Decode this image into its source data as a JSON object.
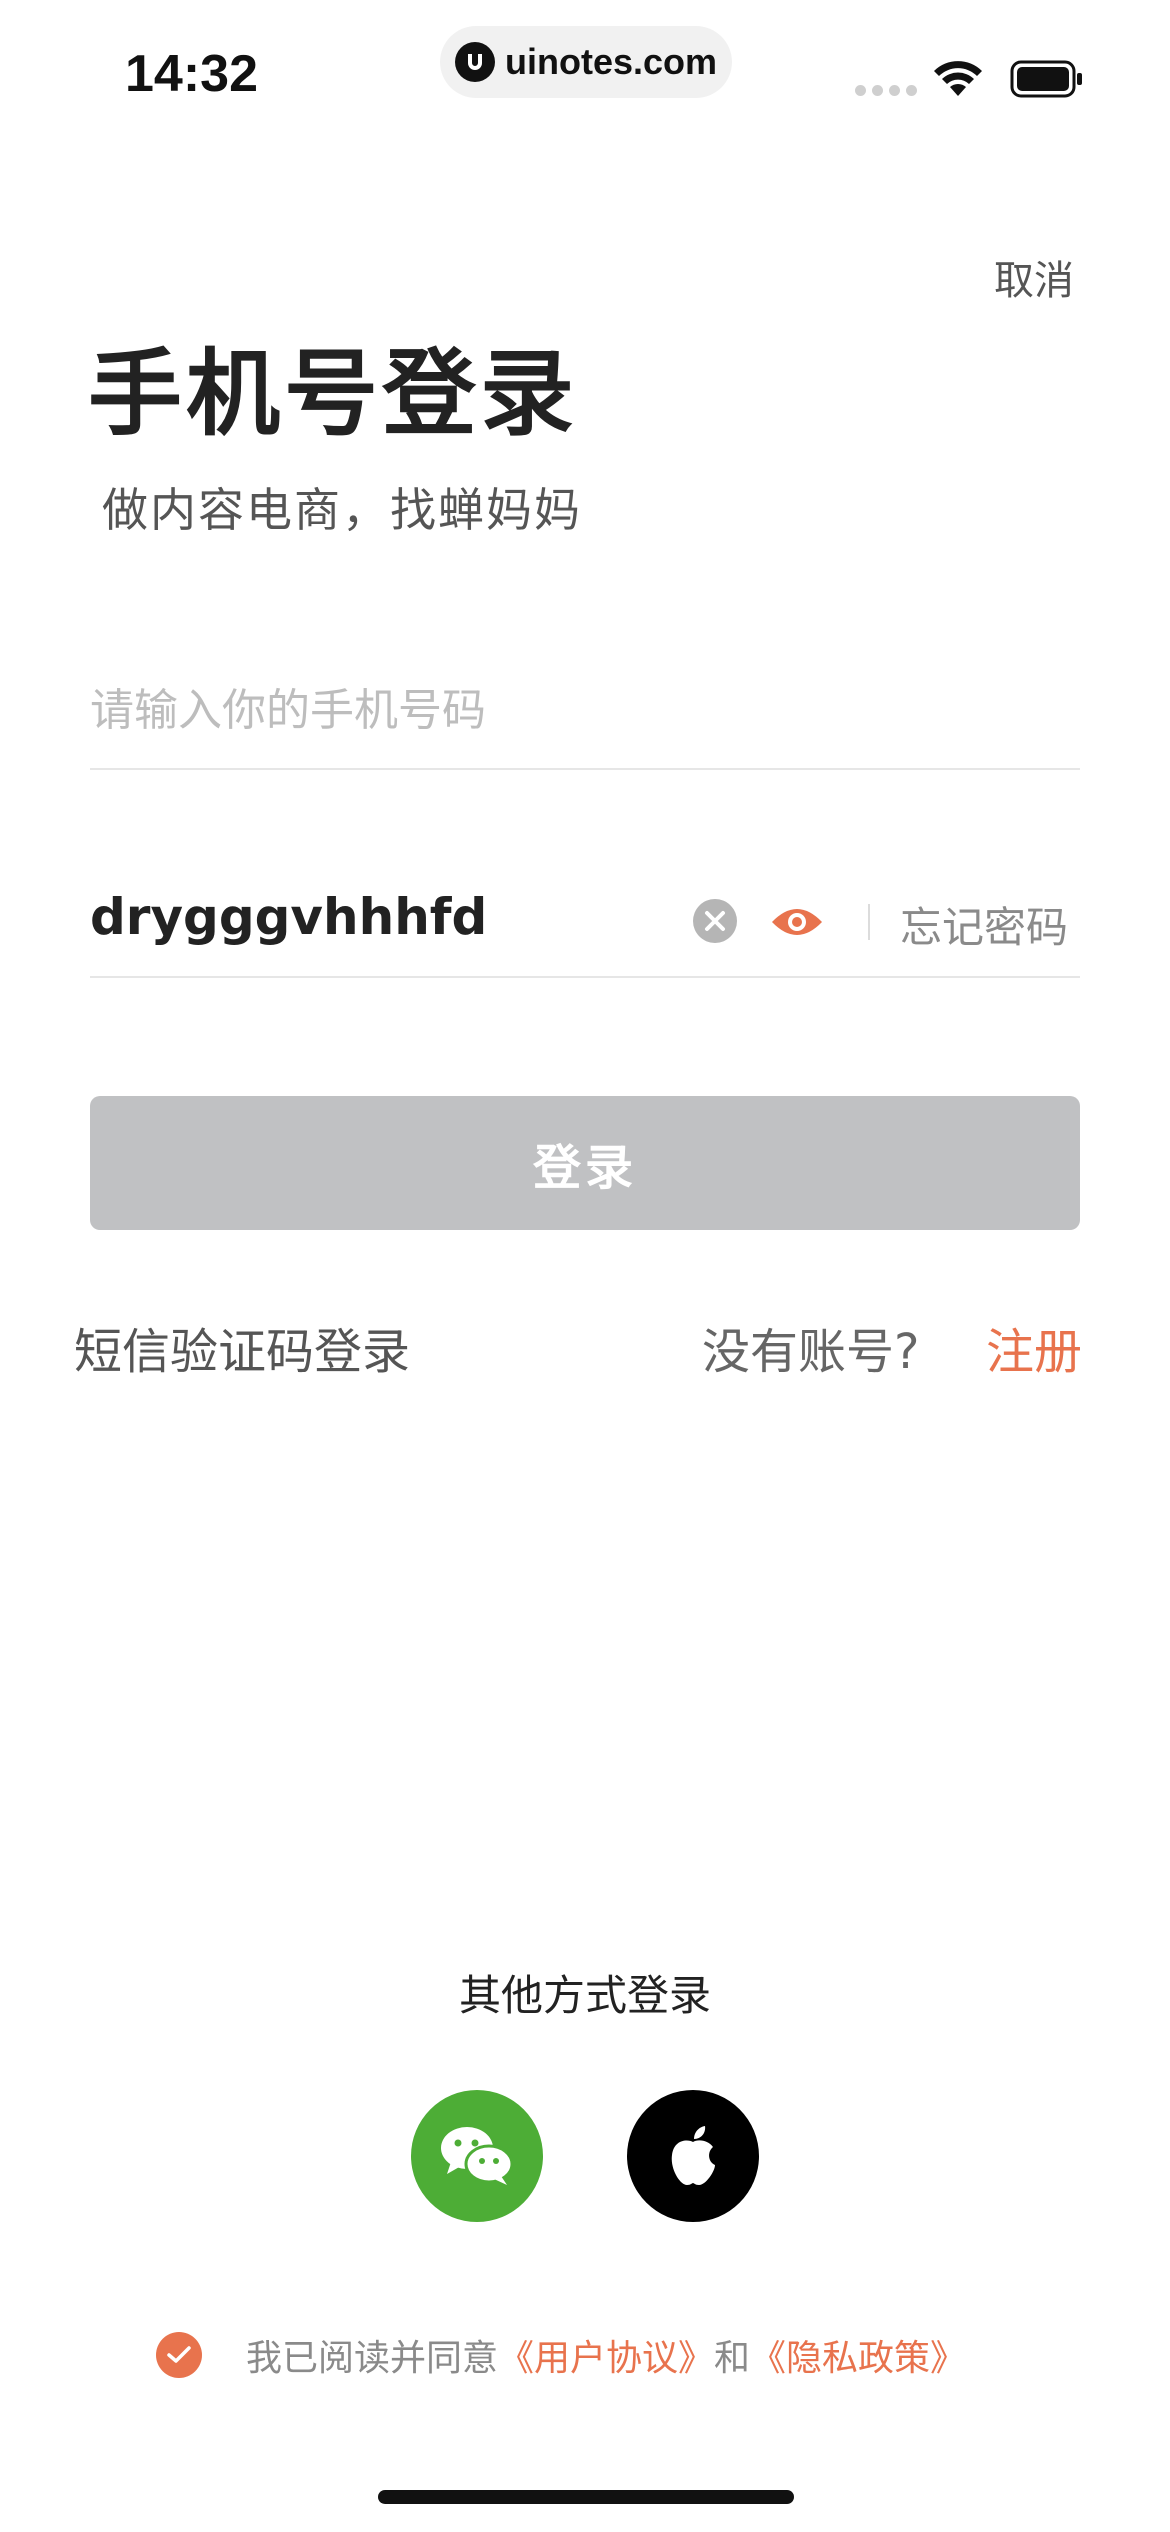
{
  "status_bar": {
    "time": "14:32",
    "url": "uinotes.com"
  },
  "header": {
    "cancel_label": "取消",
    "title": "手机号登录",
    "subtitle": "做内容电商，找蝉妈妈"
  },
  "form": {
    "phone_placeholder": "请输入你的手机号码",
    "phone_value": "",
    "password_value": "drygggvhhhfd",
    "forgot_label": "忘记密码",
    "login_label": "登录"
  },
  "links": {
    "sms_login": "短信验证码登录",
    "no_account": "没有账号?",
    "register": "注册"
  },
  "other_login": {
    "label": "其他方式登录",
    "methods": [
      "wechat-icon",
      "apple-icon"
    ]
  },
  "agreement": {
    "prefix": "我已阅读并同意",
    "user_agreement": "《用户协议》",
    "and": "和",
    "privacy_policy": "《隐私政策》",
    "checked": true
  },
  "colors": {
    "accent": "#e8734d",
    "login_disabled": "#c0c1c3",
    "wechat": "#4dad36"
  }
}
